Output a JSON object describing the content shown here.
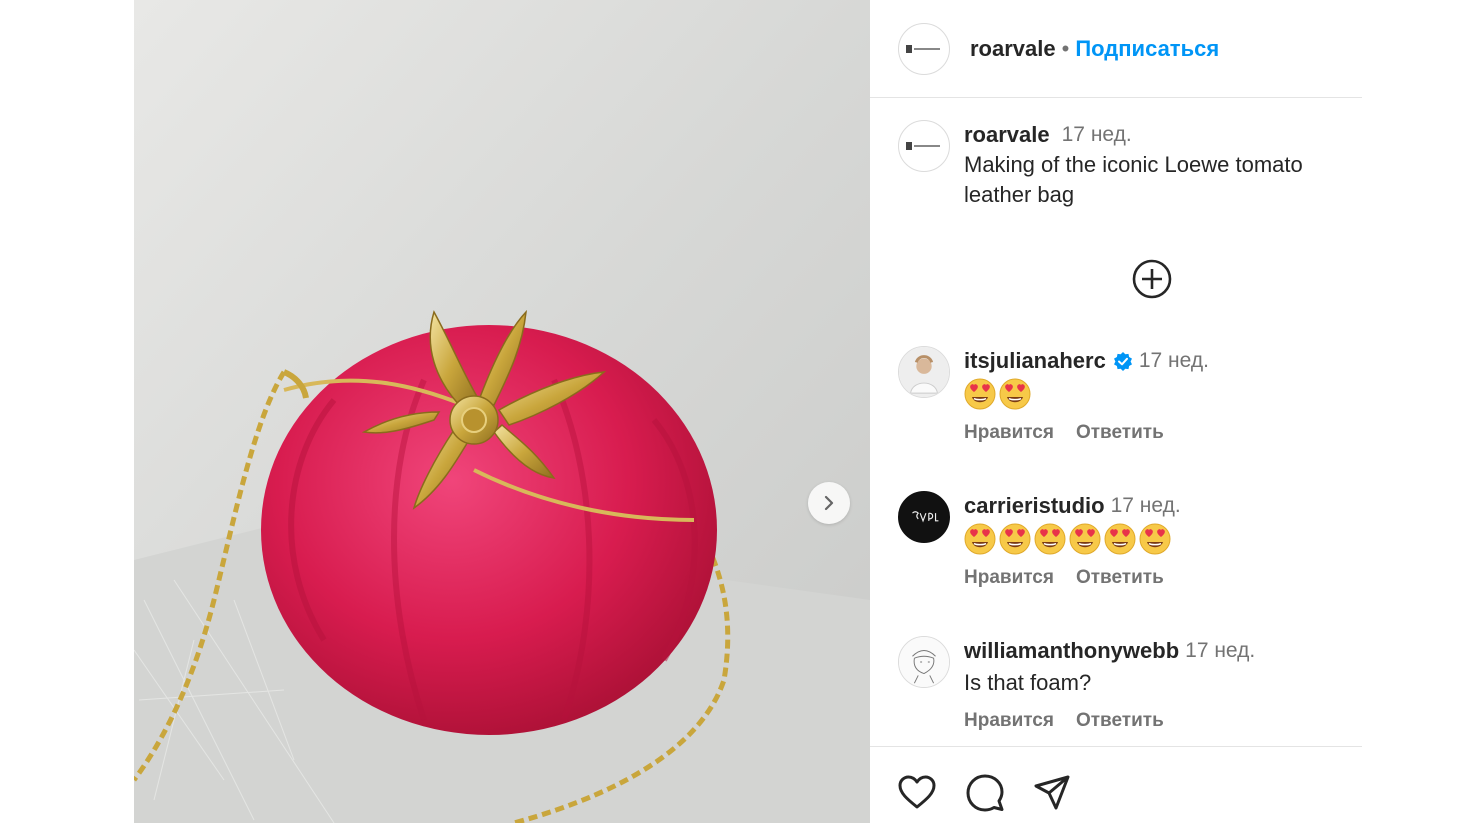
{
  "post": {
    "username": "roarvale",
    "separator": "•",
    "follow_label": "Подписаться",
    "caption": {
      "username": "roarvale",
      "time": "17 нед.",
      "text": "Making of the iconic Loewe tomato leather bag"
    }
  },
  "comments": [
    {
      "username": "itsjulianaherc",
      "verified": true,
      "time": "17 нед.",
      "emoji_count": 2,
      "like_label": "Нравится",
      "reply_label": "Ответить"
    },
    {
      "username": "carrieristudio",
      "verified": false,
      "time": "17 нед.",
      "emoji_count": 6,
      "like_label": "Нравится",
      "reply_label": "Ответить"
    },
    {
      "username": "williamanthonywebb",
      "verified": false,
      "time": "17 нед.",
      "text": "Is that foam?",
      "like_label": "Нравится",
      "reply_label": "Ответить"
    }
  ],
  "icons": {
    "next": "chevron-right-icon",
    "load_more": "plus-circle-icon",
    "like": "heart-icon",
    "comment": "comment-icon",
    "share": "send-icon",
    "verified": "verified-badge-icon",
    "emoji": "heart-eyes-emoji"
  },
  "colors": {
    "link": "#0095f6",
    "muted": "#737373",
    "text": "#262626",
    "tomato": "#d41f4a",
    "gold": "#c9a63c"
  }
}
